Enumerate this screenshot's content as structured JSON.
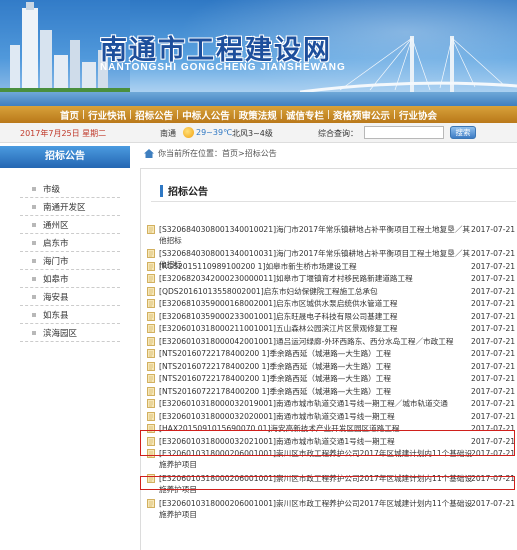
{
  "banner": {
    "title_cn": "南通市工程建设网",
    "title_en": "NANTONGSHI GONGCHENG JIANSHEWANG"
  },
  "nav": {
    "items": [
      "首页",
      "行业快讯",
      "招标公告",
      "中标人公告",
      "政策法规",
      "诚信专栏",
      "资格预审公示",
      "行业协会"
    ]
  },
  "info": {
    "date": "2017年7月25日 星期二",
    "city": "南通",
    "temperature": "29~39℃",
    "wind": "北风3~4级",
    "search_label": "综合查询：",
    "search_value": "",
    "search_button": "搜索"
  },
  "sidebar": {
    "title": "招标公告",
    "items": [
      "市级",
      "南通开发区",
      "通州区",
      "启东市",
      "海门市",
      "如皋市",
      "海安县",
      "如东县",
      "滨海园区"
    ]
  },
  "breadcrumb": {
    "prefix": "你当前所在位置：",
    "home": "首页",
    "sep": " > ",
    "current": "招标公告"
  },
  "panel": {
    "title": "招标公告"
  },
  "rows": [
    {
      "title": "[S3206840308001340010021]海门市2017年常乐镇耕地占补平衡项目工程土地复垦／其他招标",
      "date": "2017-07-21"
    },
    {
      "title": "[S3206840308001340010031]海门市2017年常乐镇耕地占补平衡项目工程土地复垦／其他招标",
      "date": "2017-07-21"
    },
    {
      "title": "[RGS2015110989100200 1]如皋市新生桥市场建设工程",
      "date": "2017-07-21"
    },
    {
      "title": "[E3206820342000230000011]如皋市丁堰镇育才村移民路新建道路工程",
      "date": "2017-07-21"
    },
    {
      "title": "[QDS20161013558002001]启东市妇幼保健院工程施工总承包",
      "date": "2017-07-21"
    },
    {
      "title": "[E3206810359000168002001]启东市区城供水泵启统供水管道工程",
      "date": "2017-07-21"
    },
    {
      "title": "[E3206810359000233001001]启东旺晟电子科技有限公司基建工程",
      "date": "2017-07-21"
    },
    {
      "title": "[E3206010318000211001001]五山森林公园滨江片区景观修复工程",
      "date": "2017-07-21"
    },
    {
      "title": "[E3206010318000042001001]通吕运河绿廊-外环西路东、西分水岛工程／市政工程",
      "date": "2017-07-21"
    },
    {
      "title": "[NTS20160722178400200 1]季余路西延（城港路—大生路）工程",
      "date": "2017-07-21"
    },
    {
      "title": "[NTS20160722178400200 1]季余路西延（城港路—大生路）工程",
      "date": "2017-07-21"
    },
    {
      "title": "[NTS20160722178400200 1]季余路西延（城港路—大生路）工程",
      "date": "2017-07-21"
    },
    {
      "title": "[NTS20160722178400200 1]季余路西延（城港路—大生路）工程",
      "date": "2017-07-21"
    },
    {
      "title": "[E3206010318000032019001]南通市城市轨道交通1号线一期工程／城市轨道交通",
      "date": "2017-07-21"
    },
    {
      "title": "[E3206010318000032020001]南通市城市轨道交通1号线一期工程",
      "date": "2017-07-21"
    },
    {
      "title": "[HAX2015091015690070 01]海安高新技术产业开发区园区道路工程",
      "date": "2017-07-21"
    },
    {
      "title": "[E3206010318000032021001]南通市城市轨道交通1号线一期工程",
      "date": "2017-07-21"
    },
    {
      "title": "[E3206010318000206001001]崇川区市政工程养护公司2017年区城建计划内11个基础设施养护项目",
      "date": "2017-07-21"
    },
    {
      "title": "[E3206010318000206001001]崇川区市政工程养护公司2017年区城建计划内11个基础设施养护项目",
      "date": "2017-07-21"
    },
    {
      "title": "[E3206010318000206001001]崇川区市政工程养护公司2017年区城建计划内11个基础设施养护项目",
      "date": "2017-07-21"
    }
  ],
  "colors": {
    "nav_gold": "#c98b26",
    "sidebar_blue": "#2f78c4",
    "highlight_red": "#d0201c",
    "date_red": "#c0392b"
  }
}
